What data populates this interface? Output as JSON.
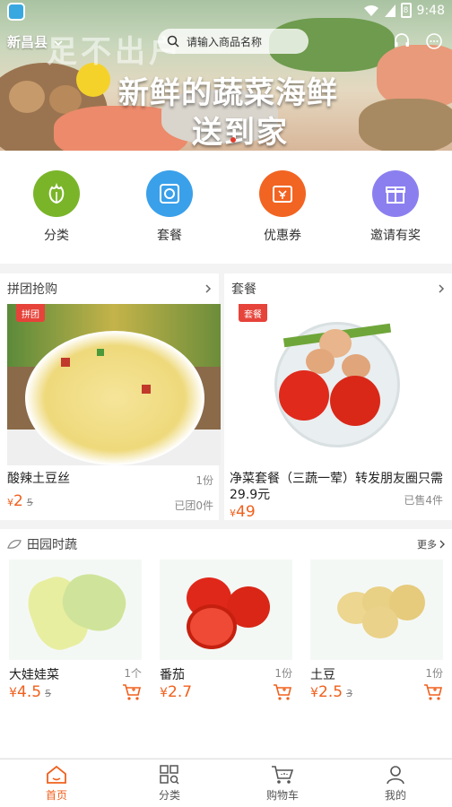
{
  "status_bar": {
    "time": "9:48",
    "battery": "8"
  },
  "header": {
    "city": "新昌县",
    "search_placeholder": "请输入商品名称"
  },
  "banner": {
    "slogan_top": "足不出户",
    "slogan_main": "新鲜的蔬菜海鲜",
    "slogan_sub": "送到家"
  },
  "quick_menu": [
    {
      "label": "分类",
      "icon": "vegetable-icon",
      "color": "#7ab529"
    },
    {
      "label": "套餐",
      "icon": "package-icon",
      "color": "#3aa0ea"
    },
    {
      "label": "优惠券",
      "icon": "coupon-icon",
      "color": "#f26422"
    },
    {
      "label": "邀请有奖",
      "icon": "gift-icon",
      "color": "#8b7ff0"
    }
  ],
  "group_buy": {
    "title": "拼团抢购",
    "tag": "拼团",
    "product": {
      "name": "酸辣土豆丝",
      "unit": "1份",
      "currency": "¥",
      "price": "2",
      "original_price": "5",
      "sold": "已团0件"
    }
  },
  "combo": {
    "title": "套餐",
    "tag": "套餐",
    "product": {
      "name": "净菜套餐（三蔬一荤）转发朋友圈只需29.9元",
      "currency": "¥",
      "price": "49",
      "sold": "已售4件"
    }
  },
  "field_veg": {
    "title": "田园时蔬",
    "more": "更多",
    "items": [
      {
        "name": "大娃娃菜",
        "unit": "1个",
        "currency": "¥",
        "price": "4.5",
        "original_price": "5"
      },
      {
        "name": "番茄",
        "unit": "1份",
        "currency": "¥",
        "price": "2.7",
        "original_price": ""
      },
      {
        "name": "土豆",
        "unit": "1份",
        "currency": "¥",
        "price": "2.5",
        "original_price": "3"
      }
    ]
  },
  "tabbar": [
    {
      "label": "首页",
      "active": true
    },
    {
      "label": "分类",
      "active": false
    },
    {
      "label": "购物车",
      "active": false
    },
    {
      "label": "我的",
      "active": false
    }
  ],
  "colors": {
    "accent": "#f0601d",
    "tag_red": "#e6433a"
  }
}
